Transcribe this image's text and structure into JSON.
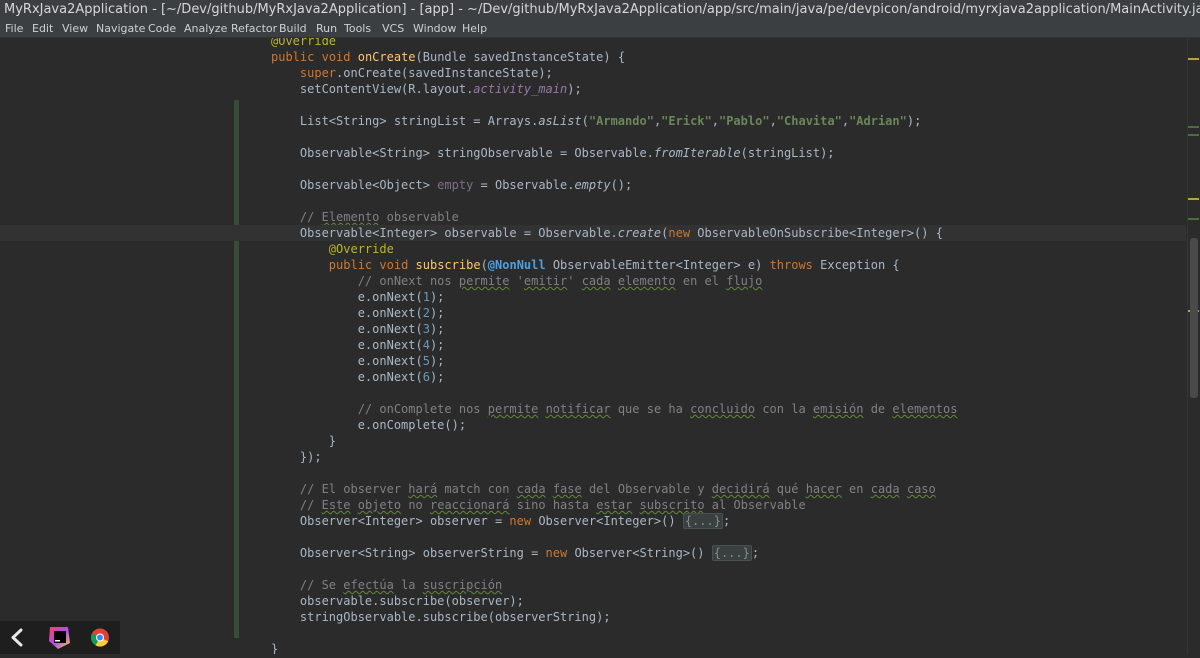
{
  "window": {
    "title": "MyRxJava2Application - [~/Dev/github/MyRxJava2Application] - [app] - ~/Dev/github/MyRxJava2Application/app/src/main/java/pe/devpicon/android/myrxjava2application/MainActivity.java - Andr…"
  },
  "menu": [
    "File",
    "Edit",
    "View",
    "Navigate",
    "Code",
    "Analyze",
    "Refactor",
    "Build",
    "Run",
    "Tools",
    "VCS",
    "Window",
    "Help"
  ],
  "editor": {
    "language": "java",
    "lines": [
      "@Override",
      "public void onCreate(Bundle savedInstanceState) {",
      "    super.onCreate(savedInstanceState);",
      "    setContentView(R.layout.activity_main);",
      "",
      "    List<String> stringList = Arrays.asList(\"Armando\",\"Erick\",\"Pablo\",\"Chavita\",\"Adrian\");",
      "",
      "    Observable<String> stringObservable = Observable.fromIterable(stringList);",
      "",
      "    Observable<Object> empty = Observable.empty();",
      "",
      "    // Elemento observable",
      "    Observable<Integer> observable = Observable.create(new ObservableOnSubscribe<Integer>() {",
      "        @Override",
      "        public void subscribe(@NonNull ObservableEmitter<Integer> e) throws Exception {",
      "            // onNext nos permite 'emitir' cada elemento en el flujo",
      "            e.onNext(1);",
      "            e.onNext(2);",
      "            e.onNext(3);",
      "            e.onNext(4);",
      "            e.onNext(5);",
      "            e.onNext(6);",
      "",
      "            // onComplete nos permite notificar que se ha concluido con la emisión de elementos",
      "            e.onComplete();",
      "        }",
      "    });",
      "",
      "    // El observer hará match con cada fase del Observable y decidirá qué hacer en cada caso",
      "    // Este objeto no reaccionará sino hasta estar subscrito al Observable",
      "    Observer<Integer> observer = new Observer<Integer>() {...};",
      "",
      "    Observer<String> observerString = new Observer<String>() {...};",
      "",
      "    // Se efectúa la suscripción",
      "    observable.subscribe(observer);",
      "    stringObservable.subscribe(observerString);",
      "",
      "}"
    ]
  },
  "taskbar": {
    "items": [
      {
        "icon": "back-arrow-icon"
      },
      {
        "icon": "intellij-app-icon"
      },
      {
        "icon": "chrome-browser-icon"
      }
    ]
  },
  "colors": {
    "editor_bg": "#2b2b2b",
    "keyword": "#cc7832",
    "string": "#6a8759",
    "comment": "#808080",
    "method_decl": "#ffc66d",
    "annotation": "#bbb529",
    "field": "#9876aa"
  }
}
